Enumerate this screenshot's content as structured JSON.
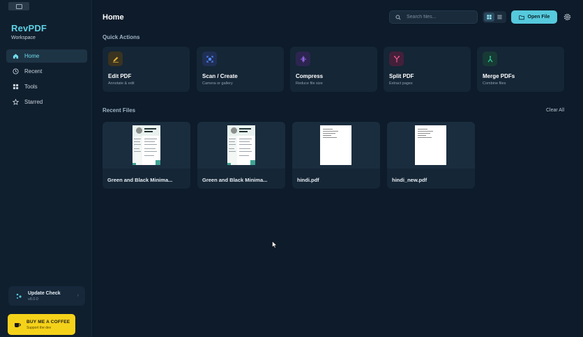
{
  "app": {
    "name": "RevPDF",
    "subtitle": "Workspace"
  },
  "sidebar": {
    "items": [
      {
        "label": "Home",
        "icon": "home-icon",
        "active": true
      },
      {
        "label": "Recent",
        "icon": "clock-icon",
        "active": false
      },
      {
        "label": "Tools",
        "icon": "grid-icon",
        "active": false
      },
      {
        "label": "Starred",
        "icon": "star-icon",
        "active": false
      }
    ],
    "update": {
      "title": "Update Check",
      "version": "v8.0.0"
    },
    "coffee": {
      "title": "BUY ME A COFFEE",
      "subtitle": "Support the dev"
    }
  },
  "header": {
    "title": "Home",
    "search_placeholder": "Search files...",
    "open_file_label": "Open File"
  },
  "quick_actions": {
    "label": "Quick Actions",
    "items": [
      {
        "title": "Edit PDF",
        "subtitle": "Annotate & edit",
        "icon": "pencil-icon",
        "color": "#e0b23c",
        "bg": "#3a3320"
      },
      {
        "title": "Scan / Create",
        "subtitle": "Camera or gallery",
        "icon": "scan-icon",
        "color": "#4f86f7",
        "bg": "#1f2f55"
      },
      {
        "title": "Compress",
        "subtitle": "Reduce file size",
        "icon": "compress-icon",
        "color": "#9b6cf0",
        "bg": "#2c2550"
      },
      {
        "title": "Split PDF",
        "subtitle": "Extract pages",
        "icon": "split-icon",
        "color": "#ec5a8a",
        "bg": "#43203a"
      },
      {
        "title": "Merge PDFs",
        "subtitle": "Combine files",
        "icon": "merge-icon",
        "color": "#2ecf9a",
        "bg": "#173a35"
      }
    ]
  },
  "recent_files": {
    "label": "Recent Files",
    "clear_label": "Clear All",
    "items": [
      {
        "name": "Green and Black Minima...",
        "thumb": "resume"
      },
      {
        "name": "Green and Black Minima...",
        "thumb": "resume"
      },
      {
        "name": "hindi.pdf",
        "thumb": "text"
      },
      {
        "name": "hindi_new.pdf",
        "thumb": "text"
      }
    ]
  },
  "colors": {
    "accent": "#56c9dc",
    "background": "#0d1b2a",
    "sidebar": "#101f2e",
    "card": "#152636",
    "coffee": "#f5d21a"
  }
}
